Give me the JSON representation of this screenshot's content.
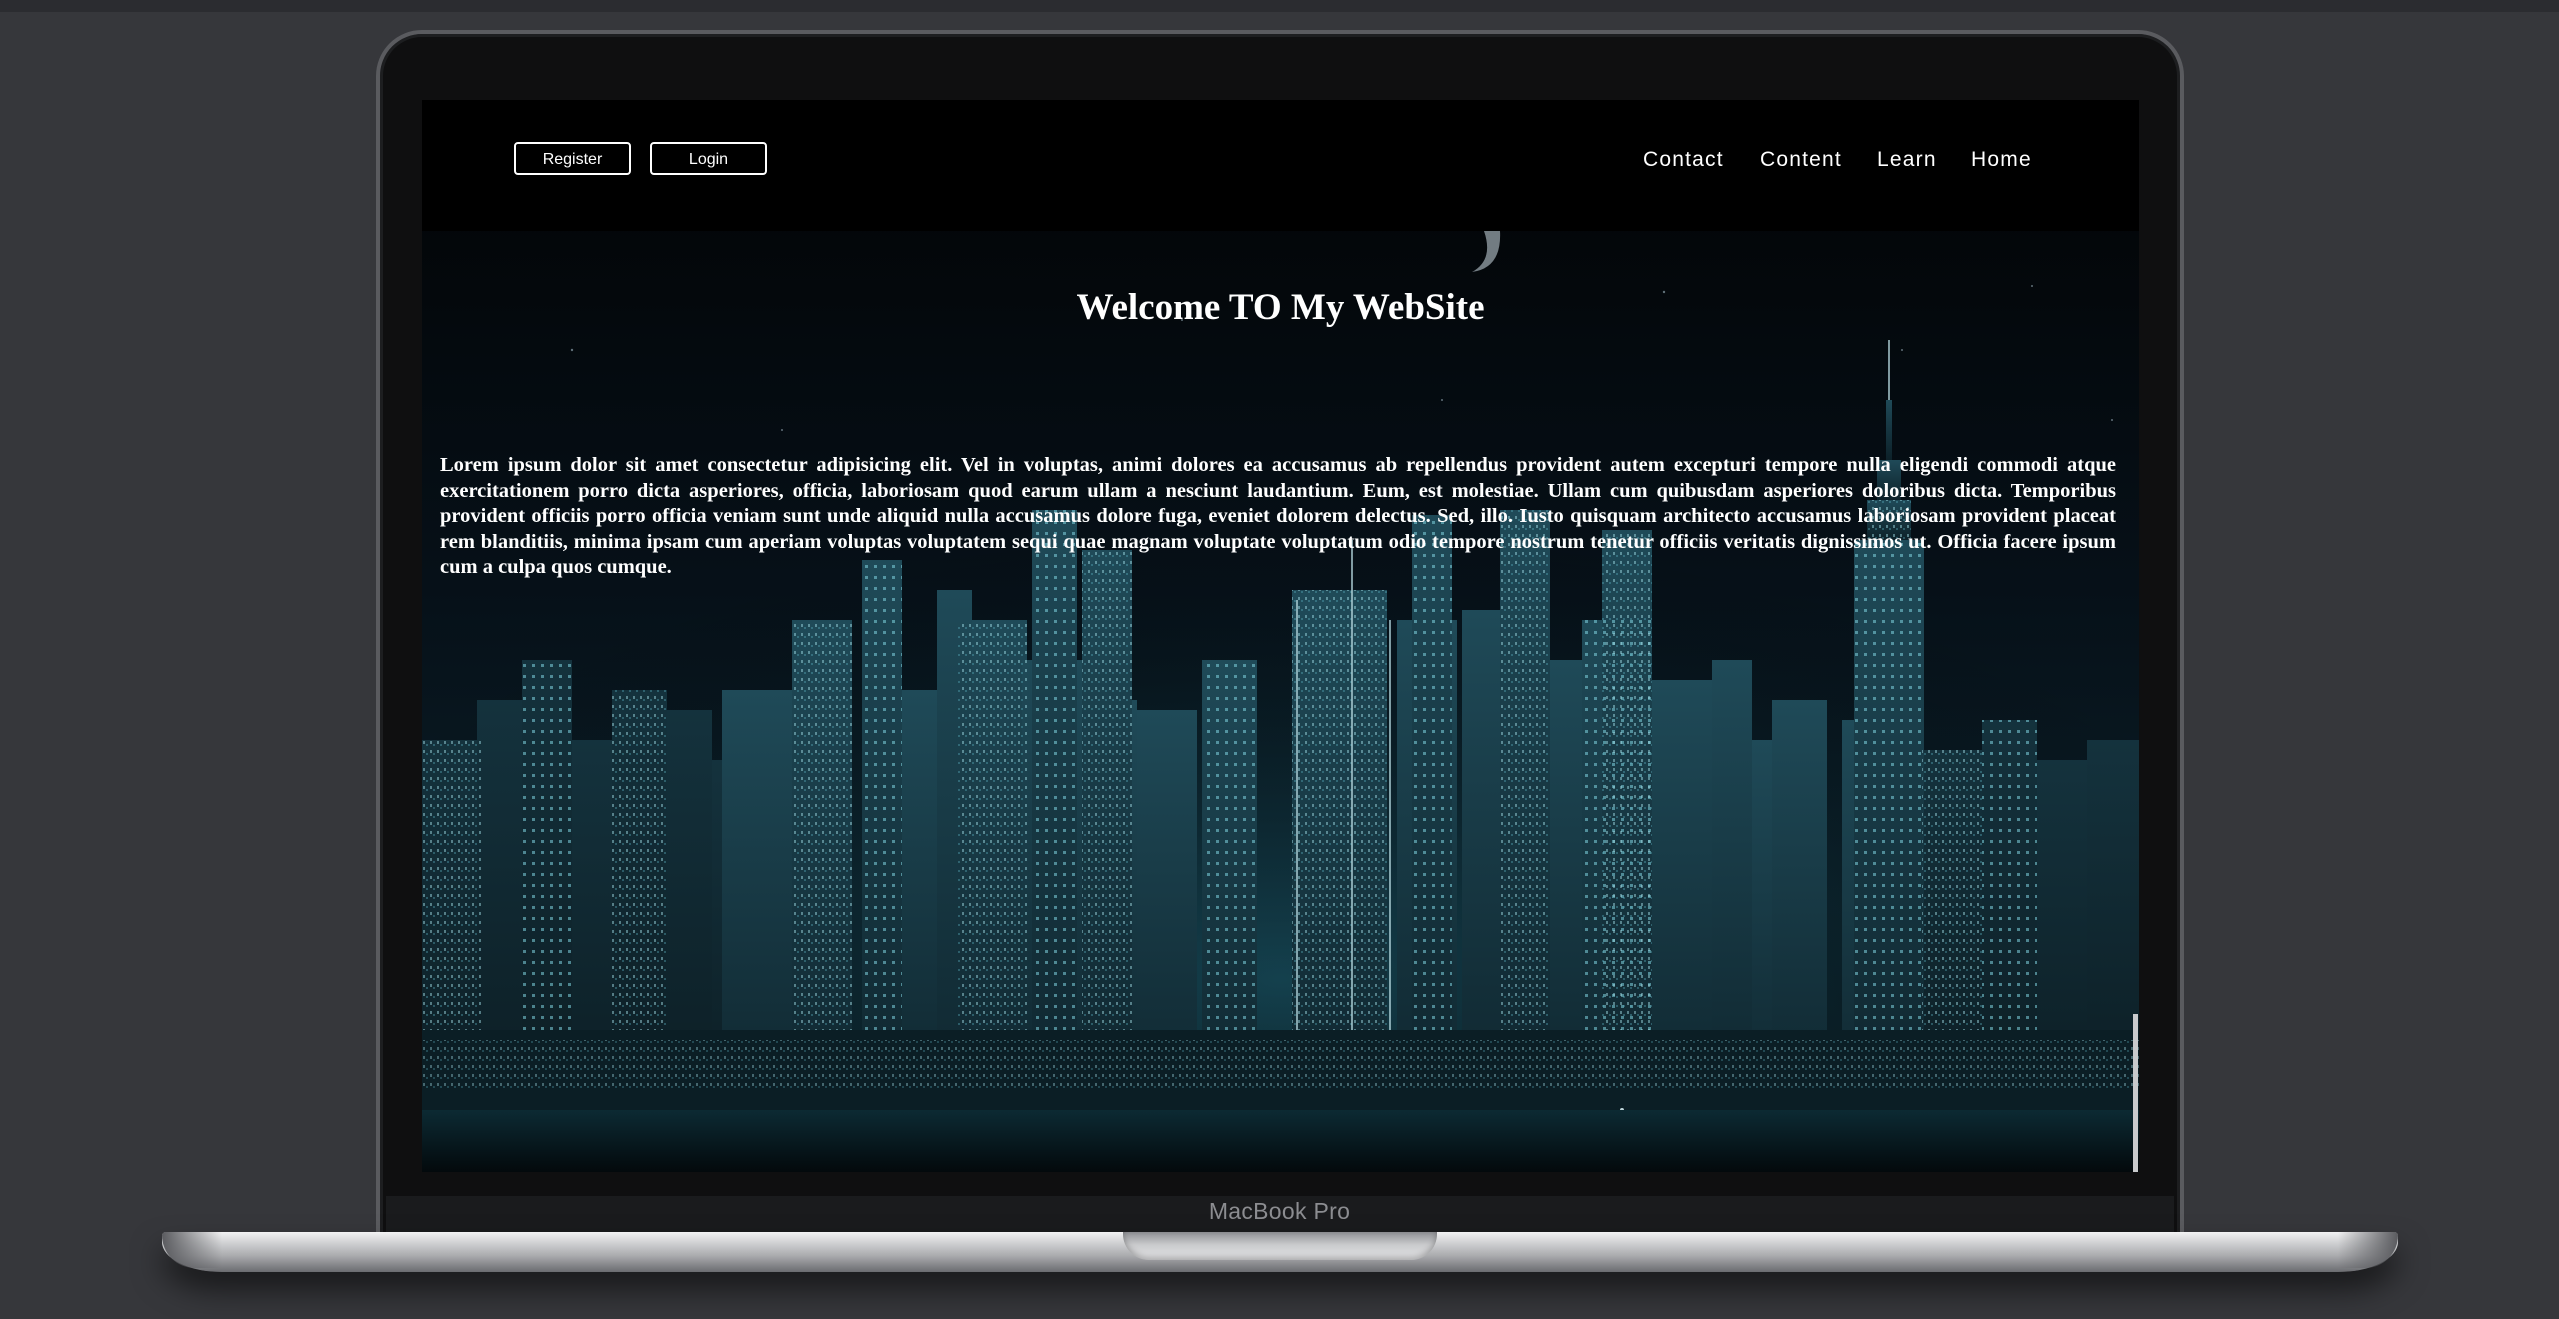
{
  "device": {
    "brand_label": "MacBook Pro"
  },
  "nav": {
    "register_label": "Register",
    "login_label": "Login",
    "links": [
      {
        "label": "Contact"
      },
      {
        "label": "Content"
      },
      {
        "label": "Learn"
      },
      {
        "label": "Home"
      }
    ]
  },
  "hero": {
    "title": "Welcome TO My WebSite",
    "paragraph": "Lorem ipsum dolor sit amet consectetur adipisicing elit. Vel in voluptas, animi dolores ea accusamus ab repellendus provident autem excepturi tempore nulla eligendi commodi atque exercitationem porro dicta asperiores, officia, laboriosam quod earum ullam a nesciunt laudantium. Eum, est molestiae. Ullam cum quibusdam asperiores doloribus dicta. Temporibus provident officiis porro officia veniam sunt unde aliquid nulla accusamus dolore fuga, eveniet dolorem delectus. Sed, illo. Iusto quisquam architecto accusamus laboriosam provident placeat rem blanditiis, minima ipsam cum aperiam voluptas voluptatem sequi quae magnam voluptate voluptatum odio tempore nostrum tenetur officiis veritatis dignissimos ut. Officia facere ipsum cum a culpa quos cumque."
  },
  "colors": {
    "page_background": "#36373b",
    "navbar": "#000000",
    "text": "#ffffff",
    "city_glow": "#2bb3c8"
  },
  "icons": {
    "hero_image": "night-city-skyline"
  }
}
